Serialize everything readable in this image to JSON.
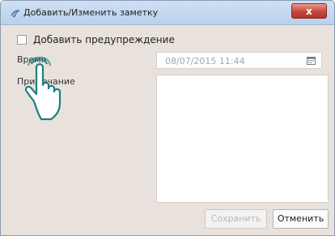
{
  "window": {
    "title": "Добавить/Изменить заметку",
    "close_glyph": "x"
  },
  "form": {
    "warning_checkbox": {
      "label": "Добавить предупреждение",
      "checked": false
    },
    "time_label": "Время",
    "note_label": "Примечание",
    "datetime": {
      "value": "08/07/2015 11:44"
    },
    "note_text": ""
  },
  "buttons": {
    "save_label": "Сохранить",
    "save_enabled": false,
    "cancel_label": "Отменить"
  },
  "icons": {
    "title_icon": "app-icon",
    "calendar_icon": "calendar-icon",
    "hand_cursor": "tap-hand-icon"
  },
  "colors": {
    "background": "#e9e2dc",
    "close_button": "#c3473a",
    "hand_outline": "#1a7f82"
  }
}
